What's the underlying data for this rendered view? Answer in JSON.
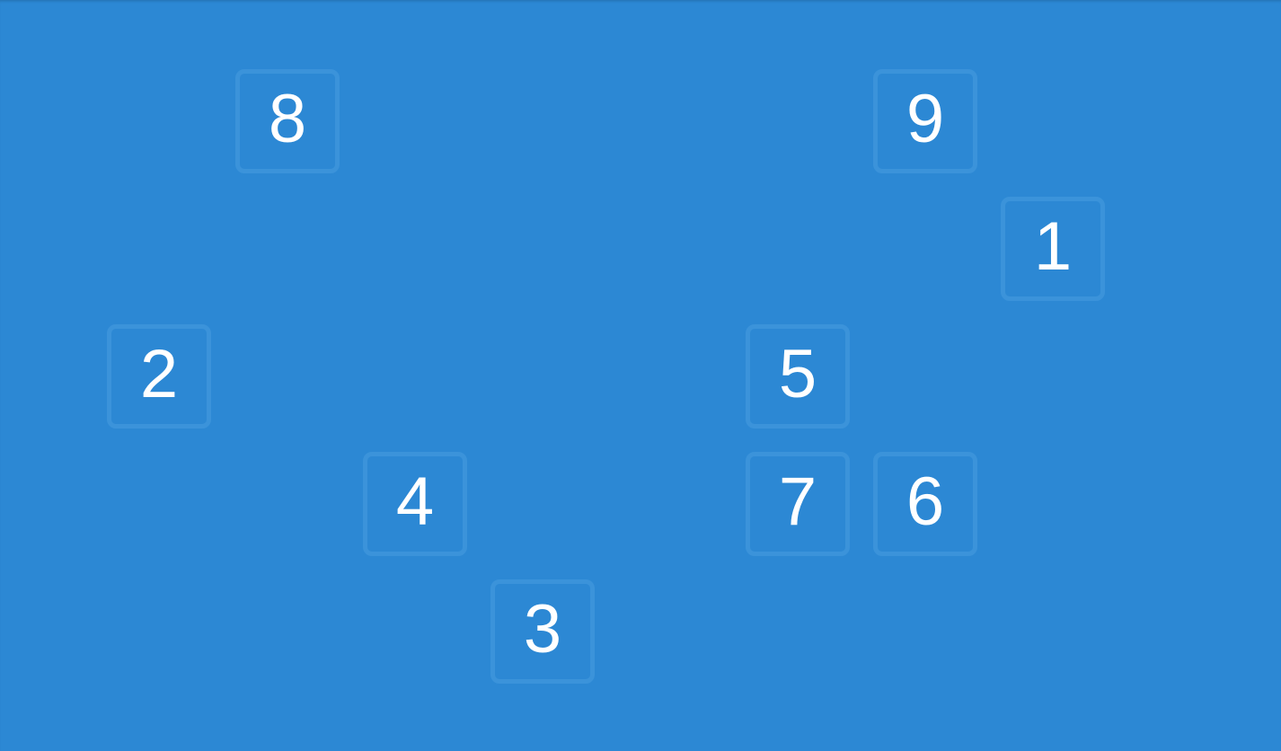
{
  "game": {
    "tiles": [
      {
        "id": "tile-8",
        "label": "8"
      },
      {
        "id": "tile-9",
        "label": "9"
      },
      {
        "id": "tile-1",
        "label": "1"
      },
      {
        "id": "tile-2",
        "label": "2"
      },
      {
        "id": "tile-5",
        "label": "5"
      },
      {
        "id": "tile-4",
        "label": "4"
      },
      {
        "id": "tile-7",
        "label": "7"
      },
      {
        "id": "tile-6",
        "label": "6"
      },
      {
        "id": "tile-3",
        "label": "3"
      }
    ]
  },
  "colors": {
    "background": "#2c88d4",
    "tile_border": "#3b93da",
    "tile_text": "#ffffff"
  }
}
